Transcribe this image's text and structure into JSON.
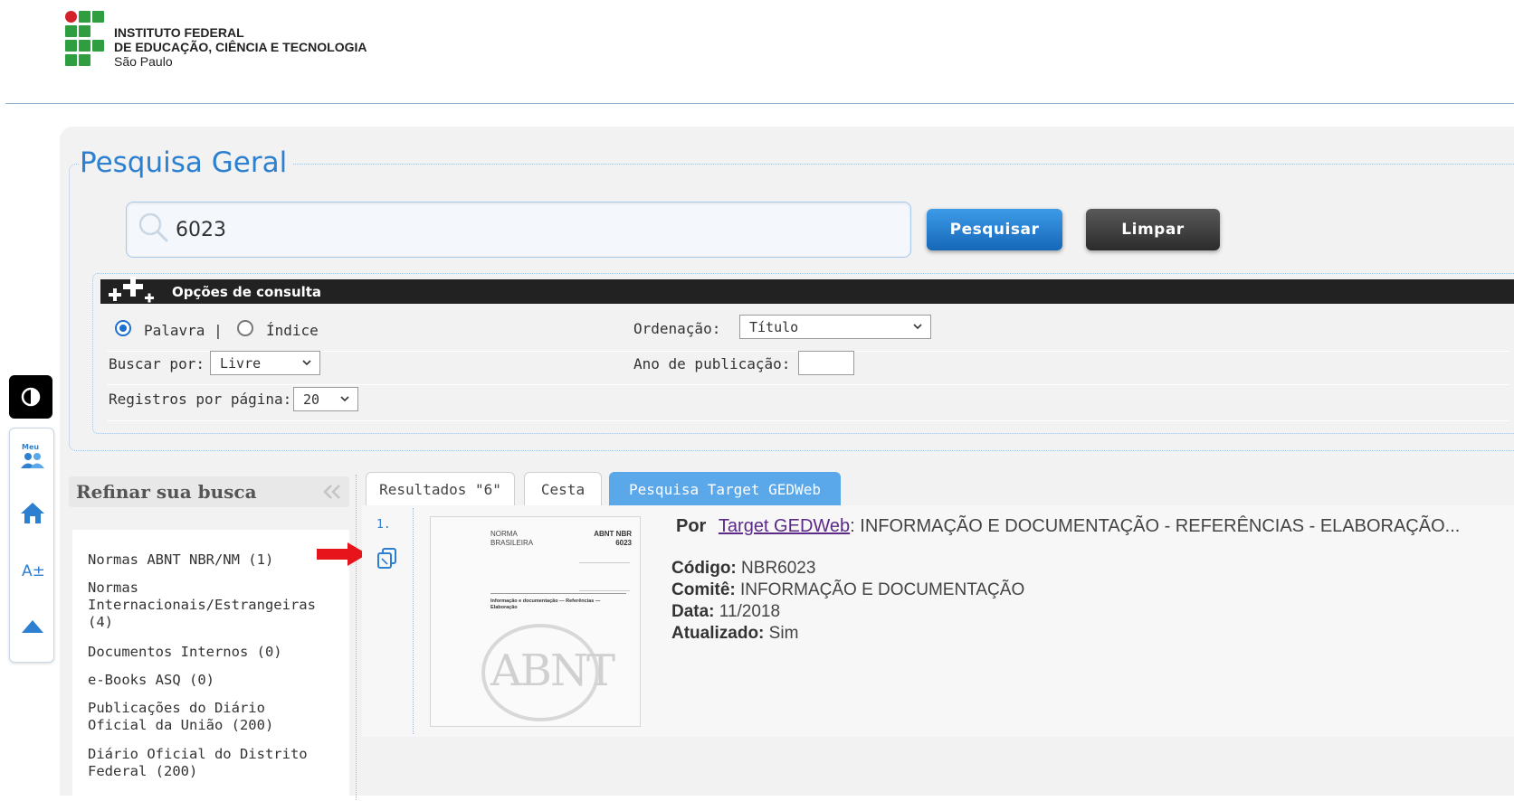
{
  "header": {
    "institution_line1": "INSTITUTO FEDERAL",
    "institution_line2": "DE EDUCAÇÃO, CIÊNCIA E TECNOLOGIA",
    "institution_line3": "São Paulo"
  },
  "search": {
    "legend": "Pesquisa Geral",
    "query": "6023",
    "search_button": "Pesquisar",
    "clear_button": "Limpar"
  },
  "options": {
    "title": "Opções de consulta",
    "radio_word": "Palavra |",
    "radio_index": "Índice",
    "search_by_label": "Buscar por:",
    "search_by_value": "Livre",
    "records_label": "Registros por página:",
    "records_value": "20",
    "order_label": "Ordenação:",
    "order_value": "Título",
    "year_label": "Ano de publicação:",
    "year_value": ""
  },
  "accessibility": {
    "meu_label": "Meu",
    "font_label": "A±"
  },
  "refine": {
    "title": "Refinar sua busca",
    "items": [
      "Normas ABNT NBR/NM (1)",
      "Normas Internacionais/Estrangeiras (4)",
      "Documentos Internos (0)",
      "e-Books ASQ (0)",
      "Publicações do Diário Oficial da União (200)",
      "Diário Oficial do Distrito Federal (200)"
    ]
  },
  "tabs": [
    {
      "label": "Resultados \"6\"",
      "active": false
    },
    {
      "label": "Cesta",
      "active": false
    },
    {
      "label": "Pesquisa Target GEDWeb",
      "active": true
    }
  ],
  "result": {
    "index": "1.",
    "by_label": "Por",
    "by_link": "Target GEDWeb",
    "title_text": ": INFORMAÇÃO E DOCUMENTAÇÃO - REFERÊNCIAS - ELABORAÇÃO...",
    "code_label": "Código:",
    "code_value": "NBR6023",
    "committee_label": "Comitê:",
    "committee_value": "INFORMAÇÃO E DOCUMENTAÇÃO",
    "date_label": "Data:",
    "date_value": "11/2018",
    "updated_label": "Atualizado:",
    "updated_value": "Sim",
    "thumb_norma": "NORMA",
    "thumb_brasileira": "BRASILEIRA",
    "thumb_abnt_nbr": "ABNT NBR",
    "thumb_number": "6023",
    "thumb_subtitle": "Informação e documentação — Referências — Elaboração",
    "thumb_logo": "ABNT"
  },
  "colors": {
    "accent_blue": "#2d7fcf",
    "search_button": "#1d74c8",
    "clear_button": "#3a3a3a",
    "active_tab": "#5aa7ea",
    "annotation_arrow": "#e8141b"
  }
}
